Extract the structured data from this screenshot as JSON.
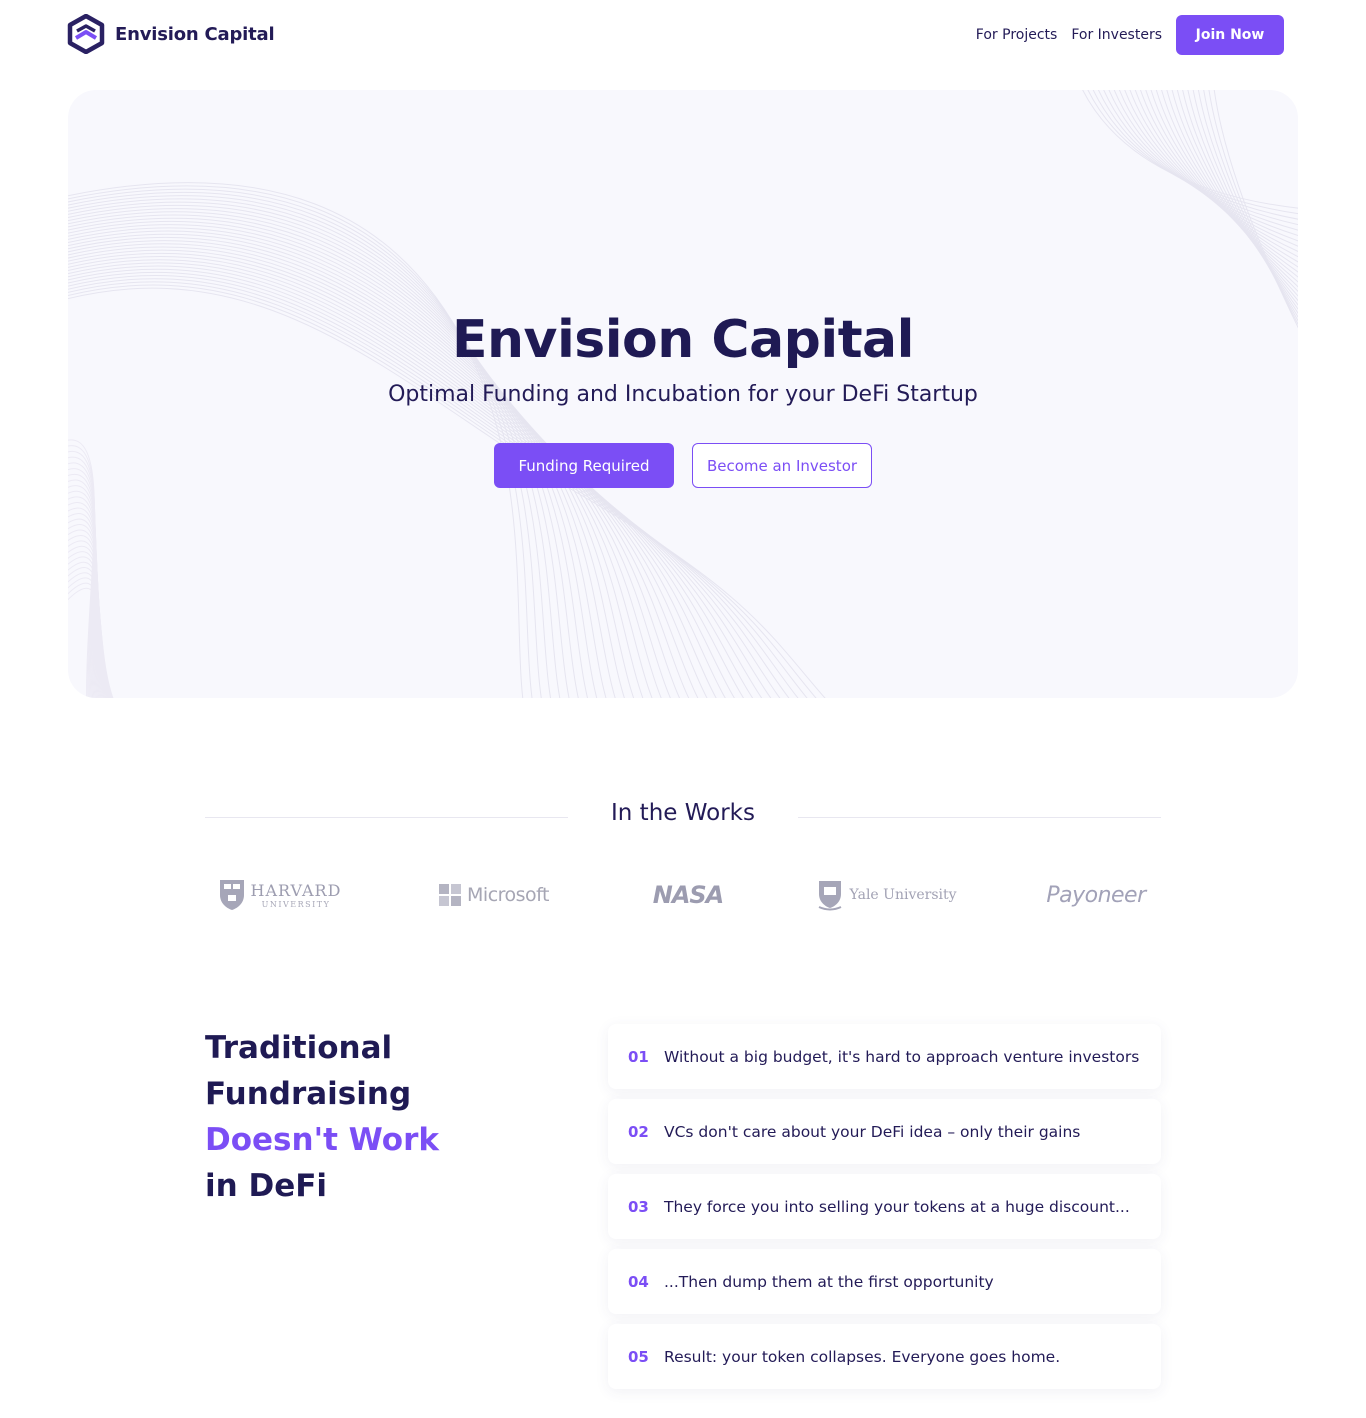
{
  "header": {
    "brand_name": "Envision Capital",
    "nav": [
      "For Projects",
      "For Investers"
    ],
    "join_label": "Join Now"
  },
  "hero": {
    "title": "Envision Capital",
    "subtitle": "Optimal Funding and Incubation for your DeFi Startup",
    "primary_button": "Funding Required",
    "secondary_button": "Become an Investor"
  },
  "works": {
    "title": "In the Works",
    "logos": {
      "harvard": {
        "name": "HARVARD",
        "sub": "UNIVERSITY"
      },
      "microsoft": "Microsoft",
      "nasa": "NASA",
      "yale": "Yale University",
      "payoneer": "Payoneer"
    }
  },
  "traditional": {
    "title_line1": "Traditional Fundraising",
    "title_line2": "Doesn't Work",
    "title_line3": "in DeFi",
    "reasons": [
      {
        "num": "01",
        "text": "Without a big budget, it's hard to approach venture investors"
      },
      {
        "num": "02",
        "text": "VCs don't care about your DeFi idea – only their gains"
      },
      {
        "num": "03",
        "text": "They force you into selling your tokens at a huge discount..."
      },
      {
        "num": "04",
        "text": "...Then dump them at the first opportunity"
      },
      {
        "num": "05",
        "text": "Result: your token collapses. Everyone goes home."
      }
    ]
  },
  "colors": {
    "accent": "#7b4ef5",
    "navy": "#1f1a54",
    "hero_bg": "#f8f8fd"
  }
}
